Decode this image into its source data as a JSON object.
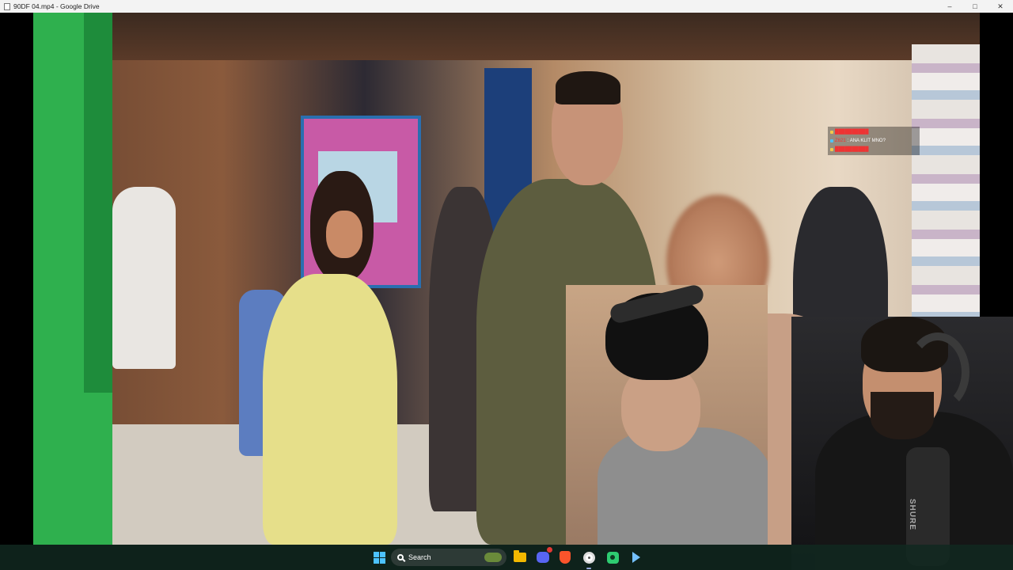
{
  "window": {
    "title": "90DF 04.mp4 - Google Drive",
    "controls": {
      "minimize": "–",
      "maximize": "□",
      "close": "✕"
    }
  },
  "stream_overlay": {
    "chat": [
      {
        "user": "██████████",
        "message": ""
      },
      {
        "user": "Z621",
        "message": ": ANA KLIT MNO?"
      },
      {
        "user": "██████████",
        "message": ""
      }
    ],
    "mic_brand": "SHURE"
  },
  "taskbar": {
    "search_label": "Search",
    "items": [
      {
        "name": "start",
        "icon": "windows-start-icon"
      },
      {
        "name": "search",
        "icon": "search-icon"
      },
      {
        "name": "file-explorer",
        "icon": "folder-icon"
      },
      {
        "name": "discord",
        "icon": "discord-icon"
      },
      {
        "name": "brave",
        "icon": "brave-icon"
      },
      {
        "name": "chrome",
        "icon": "chrome-icon"
      },
      {
        "name": "camera-app",
        "icon": "camera-app-icon"
      },
      {
        "name": "obs",
        "icon": "obs-icon"
      }
    ]
  }
}
